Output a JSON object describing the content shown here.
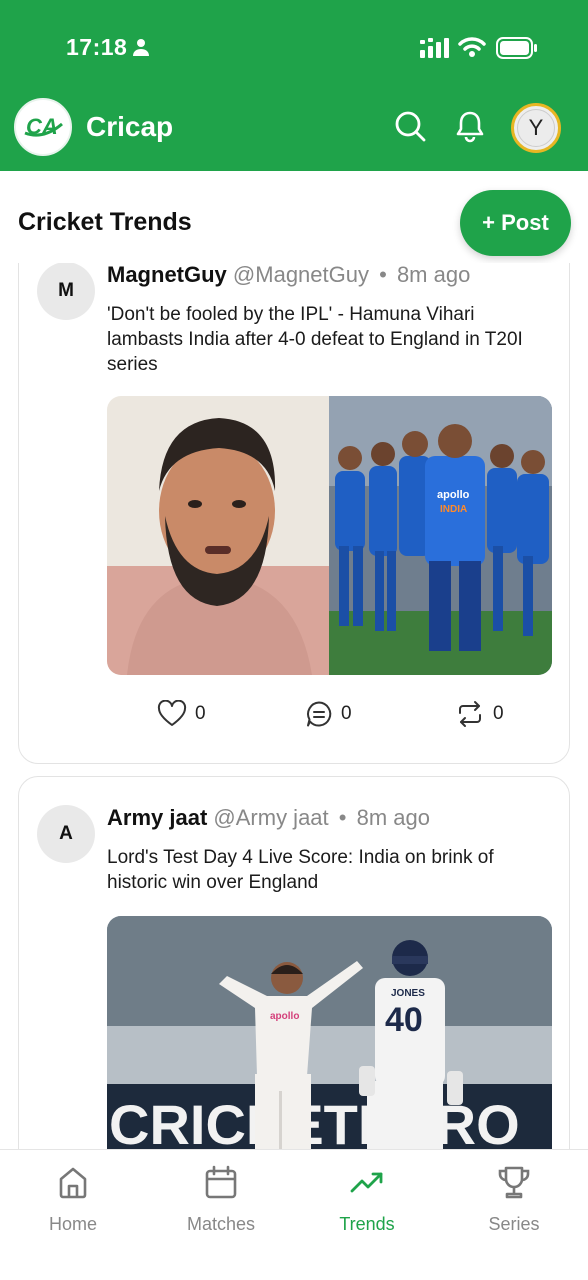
{
  "status_bar": {
    "time": "17:18"
  },
  "header": {
    "title": "Cricap",
    "avatar_initial": "Y"
  },
  "section": {
    "title": "Cricket Trends",
    "post_button": "+ Post"
  },
  "posts": [
    {
      "avatar_letter": "M",
      "name": "MagnetGuy",
      "handle": "@MagnetGuy",
      "separator": "•",
      "time_ago": "8m ago",
      "text": "'Don't be fooled by the IPL' - Hamuna Vihari lambasts India after 4-0 defeat to England in T20I series",
      "likes": "0",
      "comments": "0",
      "reposts": "0",
      "image_text": {
        "sponsor": "apollo",
        "team": "INDIA"
      }
    },
    {
      "avatar_letter": "A",
      "name": "Army jaat",
      "handle": "@Army jaat",
      "separator": "•",
      "time_ago": "8m ago",
      "text": "Lord's Test Day 4 Live Score: India on brink of historic win over England",
      "image_text": {
        "player_name": "JONES",
        "player_number": "40",
        "sponsor": "apollo",
        "board": "CRICKETHERO"
      }
    }
  ],
  "tabs": [
    {
      "label": "Home",
      "icon": "home-icon",
      "active": false
    },
    {
      "label": "Matches",
      "icon": "calendar-icon",
      "active": false
    },
    {
      "label": "Trends",
      "icon": "trending-up-icon",
      "active": true
    },
    {
      "label": "Series",
      "icon": "trophy-icon",
      "active": false
    }
  ],
  "colors": {
    "brand_green": "#1fa34a",
    "avatar_ring": "#e7b623",
    "muted_text": "#888888"
  }
}
